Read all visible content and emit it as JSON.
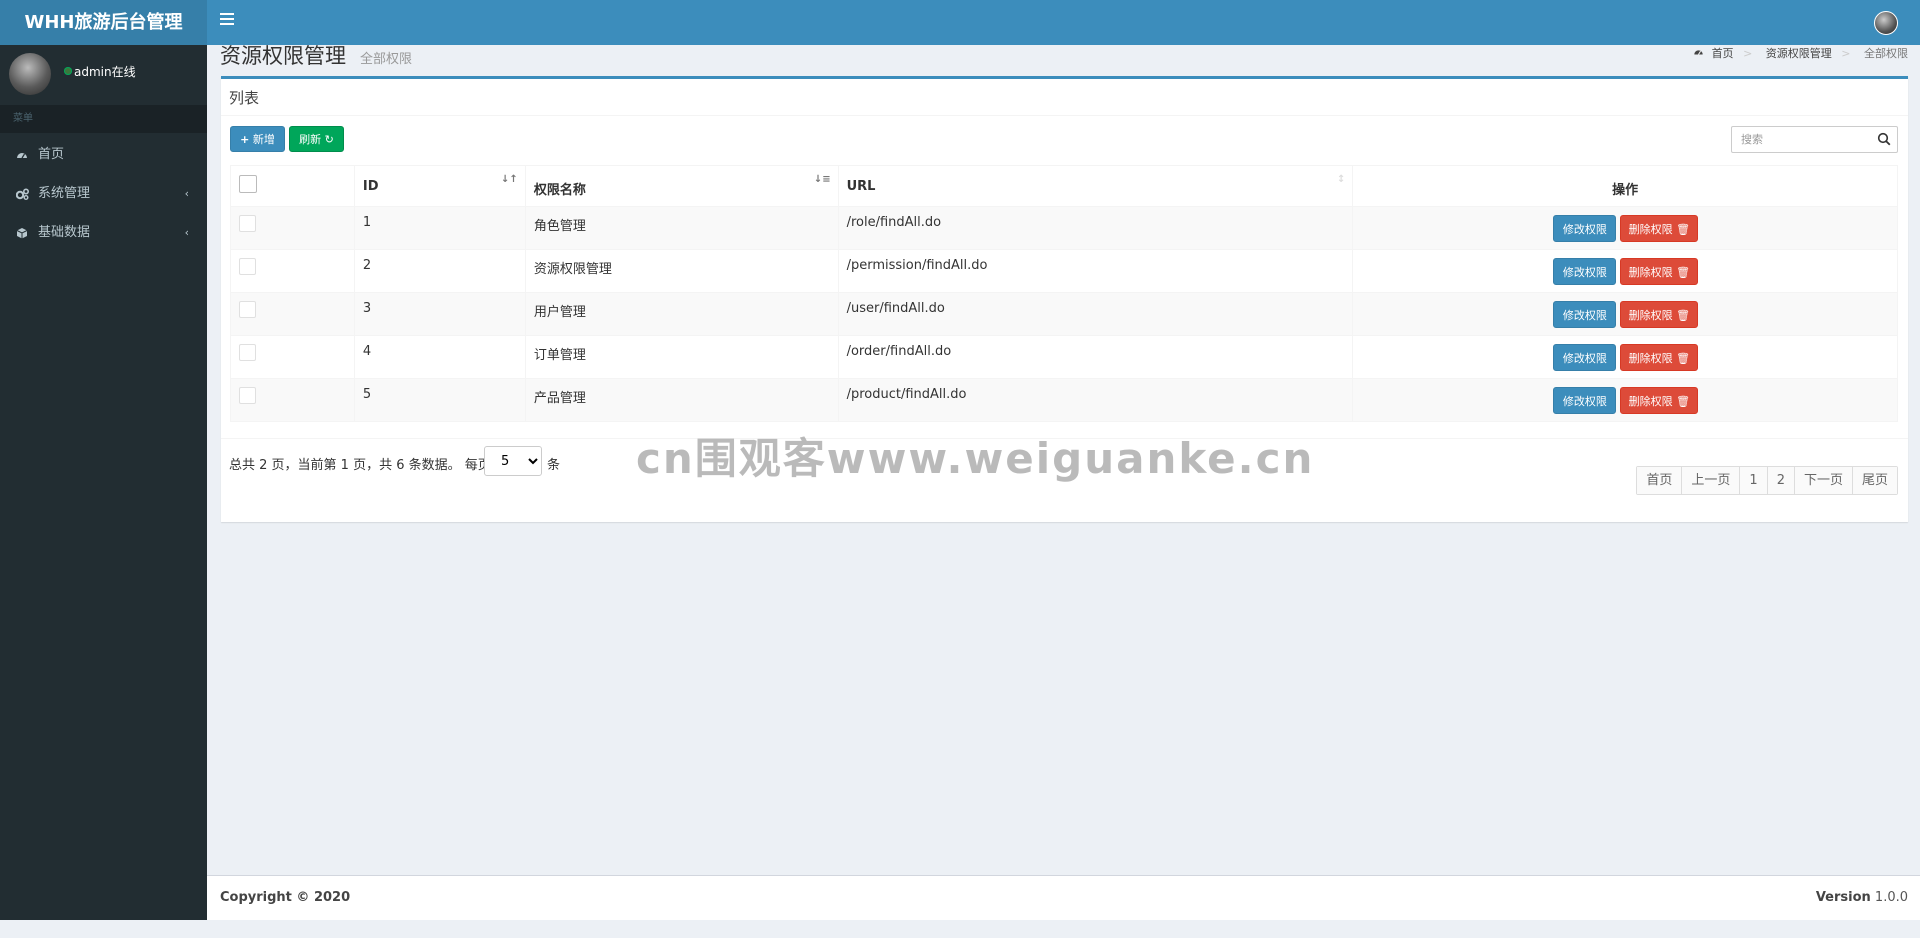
{
  "header": {
    "brand": "WHH旅游后台管理"
  },
  "sidebar": {
    "user": {
      "name": "admin在线"
    },
    "menu_header": "菜单",
    "items": [
      {
        "label": "首页",
        "icon": "dashboard-icon"
      },
      {
        "label": "系统管理",
        "icon": "cogs-icon"
      },
      {
        "label": "基础数据",
        "icon": "cube-icon"
      }
    ]
  },
  "content_header": {
    "title": "资源权限管理",
    "subtitle": "全部权限",
    "breadcrumb": [
      "首页",
      "资源权限管理",
      "全部权限"
    ]
  },
  "box": {
    "title": "列表",
    "toolbar": {
      "add_label": "新增",
      "refresh_label": "刷新"
    },
    "search": {
      "placeholder": "搜索"
    },
    "columns": [
      "ID",
      "权限名称",
      "URL",
      "操作"
    ],
    "rows": [
      {
        "id": "1",
        "name": "角色管理",
        "url": "/role/findAll.do"
      },
      {
        "id": "2",
        "name": "资源权限管理",
        "url": "/permission/findAll.do"
      },
      {
        "id": "3",
        "name": "用户管理",
        "url": "/user/findAll.do"
      },
      {
        "id": "4",
        "name": "订单管理",
        "url": "/order/findAll.do"
      },
      {
        "id": "5",
        "name": "产品管理",
        "url": "/product/findAll.do"
      }
    ],
    "row_actions": {
      "edit_label": "修改权限",
      "delete_label": "删除权限"
    },
    "pagination": {
      "info": "总共 2 页，当前第 1 页，共 6 条数据。 每页",
      "page_size": "5",
      "suffix": "条",
      "buttons": [
        "首页",
        "上一页",
        "1",
        "2",
        "下一页",
        "尾页"
      ]
    }
  },
  "footer": {
    "copyright": "Copyright © 2020",
    "version_label": "Version",
    "version_number": "1.0.0"
  },
  "watermark": "cn围观客www.weiguanke.cn",
  "colors": {
    "header": "#3c8dbc",
    "brand_bg": "#367fa9",
    "sidebar": "#222d32",
    "primary": "#3c8dbc",
    "success": "#00a65a",
    "danger": "#dd4b39"
  }
}
